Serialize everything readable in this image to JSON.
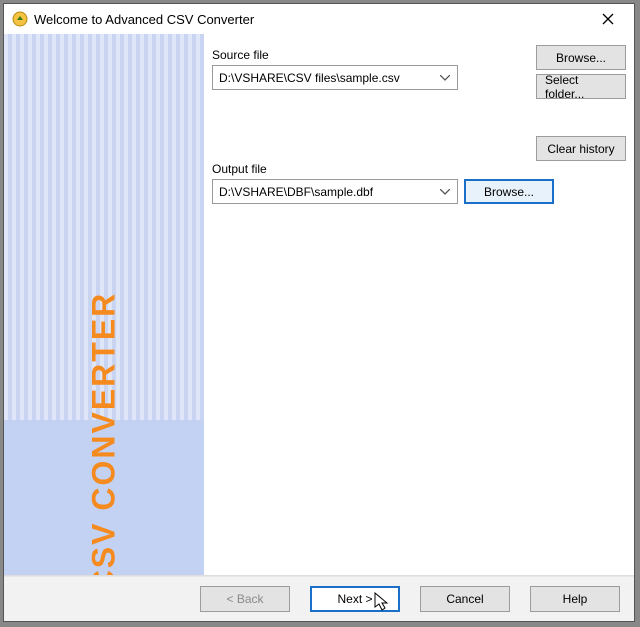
{
  "window": {
    "title": "Welcome to Advanced CSV Converter"
  },
  "sidebar": {
    "vertical_text": "CSV CONVERTER"
  },
  "labels": {
    "source": "Source file",
    "output": "Output file"
  },
  "source": {
    "value": "D:\\VSHARE\\CSV files\\sample.csv"
  },
  "output": {
    "value": "D:\\VSHARE\\DBF\\sample.dbf"
  },
  "buttons": {
    "browse_source": "Browse...",
    "select_folder": "Select folder...",
    "clear_history": "Clear history",
    "browse_output": "Browse...",
    "back": "< Back",
    "next": "Next >",
    "cancel": "Cancel",
    "help": "Help"
  }
}
